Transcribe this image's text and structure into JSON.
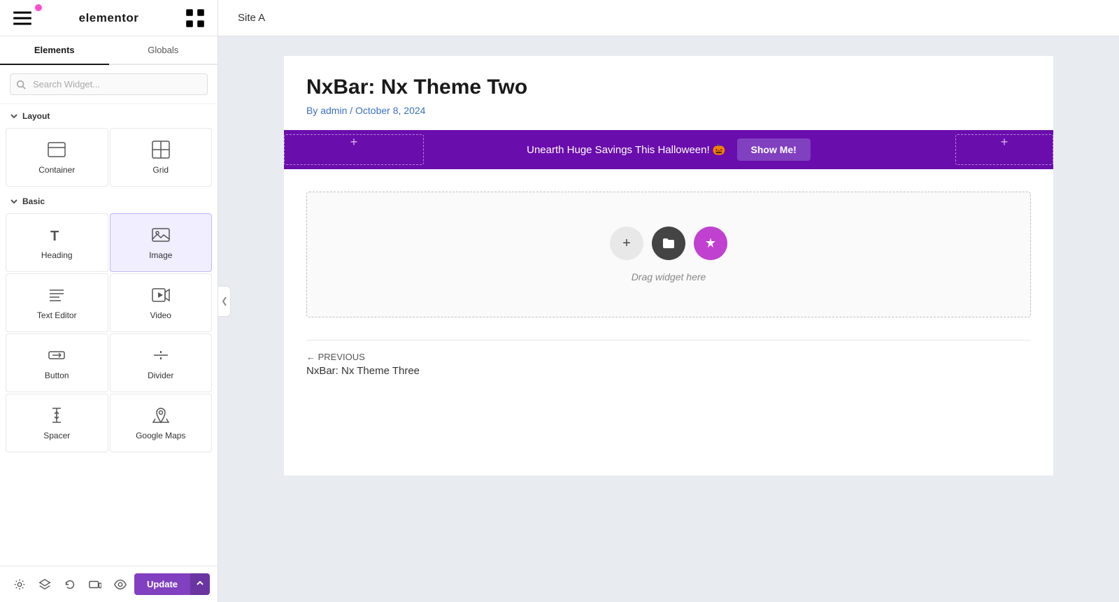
{
  "sidebar": {
    "logo": "elementor",
    "tabs": [
      {
        "label": "Elements",
        "active": true
      },
      {
        "label": "Globals",
        "active": false
      }
    ],
    "search_placeholder": "Search Widget...",
    "sections": [
      {
        "name": "Layout",
        "widgets": [
          {
            "id": "container",
            "label": "Container"
          },
          {
            "id": "grid",
            "label": "Grid"
          }
        ]
      },
      {
        "name": "Basic",
        "widgets": [
          {
            "id": "heading",
            "label": "Heading",
            "active": false
          },
          {
            "id": "image",
            "label": "Image",
            "active": true
          },
          {
            "id": "text-editor",
            "label": "Text Editor",
            "active": false
          },
          {
            "id": "video",
            "label": "Video"
          },
          {
            "id": "button",
            "label": "Button"
          },
          {
            "id": "divider",
            "label": "Divider"
          },
          {
            "id": "spacer",
            "label": "Spacer"
          },
          {
            "id": "google-maps",
            "label": "Google Maps"
          }
        ]
      }
    ],
    "footer": {
      "icons": [
        "settings",
        "layers",
        "history",
        "responsive",
        "preview"
      ],
      "update_label": "Update"
    }
  },
  "main": {
    "site_name": "Site A",
    "post_title": "NxBar: Nx Theme Two",
    "post_meta": "By admin / October 8, 2024",
    "banner": {
      "text": "Unearth Huge Savings This Halloween! 🎃",
      "button_label": "Show Me!"
    },
    "drop_zone_label": "Drag widget here",
    "previous_label": "← PREVIOUS",
    "previous_title": "NxBar: Nx Theme Three"
  }
}
